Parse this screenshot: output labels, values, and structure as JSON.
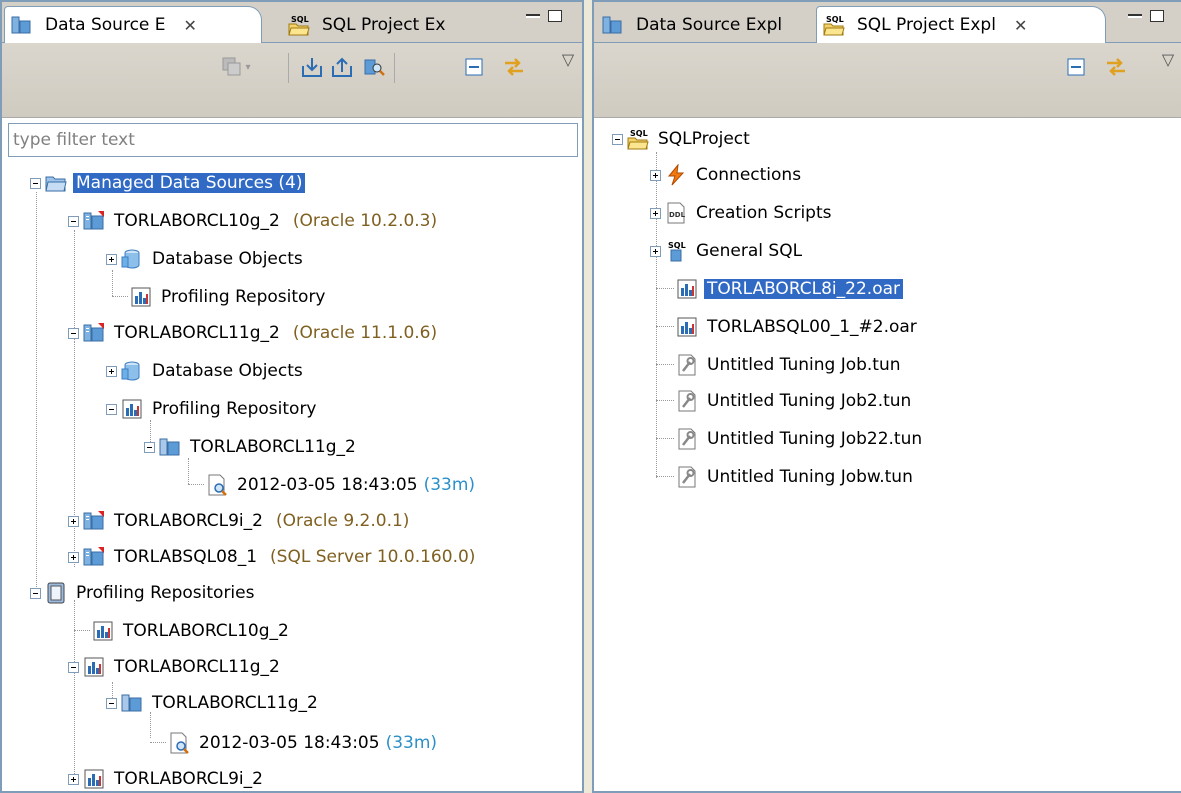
{
  "left_panel": {
    "tabs": [
      {
        "label": "Data Source E",
        "icon": "data-source-icon",
        "close": "✕"
      },
      {
        "label": "SQL Project Ex",
        "icon": "sql-project-icon"
      }
    ],
    "filter_placeholder": "type filter text",
    "tree": {
      "managed": {
        "label": "Managed Data Sources (4)"
      },
      "oracle10": {
        "label": "TORLABORCL10g_2",
        "meta": "(Oracle 10.2.0.3)"
      },
      "oracle10_dbobjects": {
        "label": "Database Objects"
      },
      "oracle10_profrepo": {
        "label": "Profiling Repository"
      },
      "oracle11": {
        "label": "TORLABORCL11g_2",
        "meta": "(Oracle 11.1.0.6)"
      },
      "oracle11_dbobjects": {
        "label": "Database Objects"
      },
      "oracle11_profrepo": {
        "label": "Profiling Repository"
      },
      "oracle11_instance": {
        "label": "TORLABORCL11g_2"
      },
      "oracle11_snapshot": {
        "label": "2012-03-05 18:43:05",
        "meta": "(33m)"
      },
      "oracle9": {
        "label": "TORLABORCL9i_2",
        "meta": "(Oracle 9.2.0.1)"
      },
      "sqlserver": {
        "label": "TORLABSQL08_1",
        "meta": "(SQL Server 10.0.160.0)"
      },
      "profiling_repos": {
        "label": "Profiling Repositories"
      },
      "pr_10g": {
        "label": "TORLABORCL10g_2"
      },
      "pr_11g": {
        "label": "TORLABORCL11g_2"
      },
      "pr_11g_instance": {
        "label": "TORLABORCL11g_2"
      },
      "pr_11g_snapshot": {
        "label": "2012-03-05 18:43:05",
        "meta": "(33m)"
      },
      "pr_9i": {
        "label": "TORLABORCL9i_2"
      }
    }
  },
  "right_panel": {
    "tabs": [
      {
        "label": "Data Source Expl",
        "icon": "data-source-icon"
      },
      {
        "label": "SQL Project Expl",
        "icon": "sql-project-icon",
        "close": "✕"
      }
    ],
    "tree": {
      "project": {
        "label": "SQLProject"
      },
      "connections": {
        "label": "Connections"
      },
      "creation_scripts": {
        "label": "Creation Scripts"
      },
      "general_sql": {
        "label": "General SQL"
      },
      "oar1": {
        "label": "TORLABORCL8i_22.oar"
      },
      "oar2": {
        "label": "TORLABSQL00_1_#2.oar"
      },
      "tun1": {
        "label": "Untitled Tuning Job.tun"
      },
      "tun2": {
        "label": "Untitled Tuning Job2.tun"
      },
      "tun3": {
        "label": "Untitled Tuning Job22.tun"
      },
      "tun4": {
        "label": "Untitled Tuning Jobw.tun"
      }
    }
  },
  "colors": {
    "selection": "#316ac5",
    "meta_oracle": "#806020",
    "meta_time": "#2b8fc9"
  }
}
